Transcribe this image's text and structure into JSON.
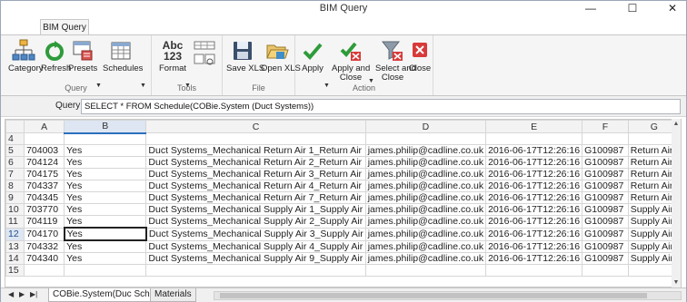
{
  "window": {
    "title": "BIM Query",
    "minimize_glyph": "—",
    "maximize_glyph": "☐",
    "close_glyph": "✕"
  },
  "ribbon": {
    "tab": "BIM Query",
    "groups": {
      "query": {
        "label": "Query",
        "category": "Category",
        "refresh": "Refresh",
        "presets": "Presets",
        "schedules": "Schedules"
      },
      "tools": {
        "label": "Tools",
        "format_line1": "Abc",
        "format_line2": "123",
        "format": "Format"
      },
      "file": {
        "label": "File",
        "save_xls": "Save XLS",
        "open_xls": "Open XLS"
      },
      "action": {
        "label": "Action",
        "apply": "Apply",
        "apply_close_1": "Apply and",
        "apply_close_2": "Close",
        "select_close_1": "Select and",
        "select_close_2": "Close",
        "close": "Close"
      }
    }
  },
  "query": {
    "label": "Query:",
    "value": "SELECT * FROM Schedule(COBie.System (Duct Systems))"
  },
  "grid": {
    "columns": [
      "A",
      "B",
      "C",
      "D",
      "E",
      "F",
      "G"
    ],
    "empty_rows": [
      "4"
    ],
    "rows": [
      {
        "num": "5",
        "cells": [
          "704003",
          "Yes",
          "Duct Systems_Mechanical Return Air 1_Return Air",
          "james.philip@cadline.co.uk",
          "2016-06-17T12:26:16",
          "G100987",
          "Return Air"
        ]
      },
      {
        "num": "6",
        "cells": [
          "704124",
          "Yes",
          "Duct Systems_Mechanical Return Air 2_Return Air",
          "james.philip@cadline.co.uk",
          "2016-06-17T12:26:16",
          "G100987",
          "Return Air"
        ]
      },
      {
        "num": "7",
        "cells": [
          "704175",
          "Yes",
          "Duct Systems_Mechanical Return Air 3_Return Air",
          "james.philip@cadline.co.uk",
          "2016-06-17T12:26:16",
          "G100987",
          "Return Air"
        ]
      },
      {
        "num": "8",
        "cells": [
          "704337",
          "Yes",
          "Duct Systems_Mechanical Return Air 4_Return Air",
          "james.philip@cadline.co.uk",
          "2016-06-17T12:26:16",
          "G100987",
          "Return Air"
        ]
      },
      {
        "num": "9",
        "cells": [
          "704345",
          "Yes",
          "Duct Systems_Mechanical Return Air 7_Return Air",
          "james.philip@cadline.co.uk",
          "2016-06-17T12:26:16",
          "G100987",
          "Return Air"
        ]
      },
      {
        "num": "10",
        "cells": [
          "703770",
          "Yes",
          "Duct Systems_Mechanical Supply Air 1_Supply Air",
          "james.philip@cadline.co.uk",
          "2016-06-17T12:26:16",
          "G100987",
          "Supply Air"
        ]
      },
      {
        "num": "11",
        "cells": [
          "704119",
          "Yes",
          "Duct Systems_Mechanical Supply Air 2_Supply Air",
          "james.philip@cadline.co.uk",
          "2016-06-17T12:26:16",
          "G100987",
          "Supply Air"
        ]
      },
      {
        "num": "12",
        "cells": [
          "704170",
          "Yes",
          "Duct Systems_Mechanical Supply Air 3_Supply Air",
          "james.philip@cadline.co.uk",
          "2016-06-17T12:26:16",
          "G100987",
          "Supply Air"
        ]
      },
      {
        "num": "13",
        "cells": [
          "704332",
          "Yes",
          "Duct Systems_Mechanical Supply Air 4_Supply Air",
          "james.philip@cadline.co.uk",
          "2016-06-17T12:26:16",
          "G100987",
          "Supply Air"
        ]
      },
      {
        "num": "14",
        "cells": [
          "704340",
          "Yes",
          "Duct Systems_Mechanical Supply Air 9_Supply Air",
          "james.philip@cadline.co.uk",
          "2016-06-17T12:26:16",
          "G100987",
          "Supply Air"
        ]
      },
      {
        "num": "15",
        "cells": [
          "",
          "",
          "",
          "",
          "",
          "",
          ""
        ]
      }
    ],
    "selected_column": "B",
    "selected_row": "12"
  },
  "sheets": {
    "nav": [
      "◀",
      "▶",
      "▶|"
    ],
    "tabs": [
      "COBie.System(Duc Schedule",
      "Materials"
    ]
  },
  "colors": {
    "accent": "#2d6fbe",
    "check_green": "#2e9b3a",
    "close_red": "#d83a3a"
  }
}
